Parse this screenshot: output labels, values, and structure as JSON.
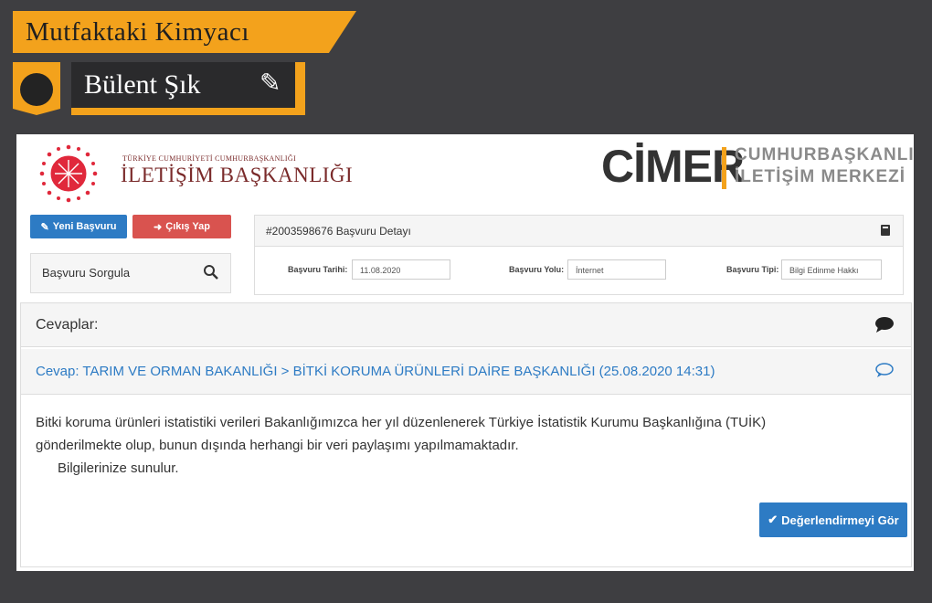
{
  "header": {
    "brand": "Mutfaktaki Kimyacı",
    "author": "Bülent Şık",
    "pencil_icon": "pencil-icon"
  },
  "site": {
    "institution_small": "TÜRKİYE CUMHURİYETİ CUMHURBAŞKANLIĞI",
    "institution_name": "İLETİŞİM BAŞKANLIĞI",
    "cimer": "CİMER",
    "cimer_line1": "CUMHURBAŞKANLIĞI",
    "cimer_line2": "İLETİŞİM MERKEZİ"
  },
  "sidebar": {
    "new_application": "Yeni Başvuru",
    "logout": "Çıkış Yap",
    "search_label": "Başvuru Sorgula"
  },
  "detail": {
    "title": "#2003598676 Başvuru Detayı",
    "date_label": "Başvuru Tarihi:",
    "date_value": "11.08.2020",
    "channel_label": "Başvuru Yolu:",
    "channel_value": "İnternet",
    "type_label": "Başvuru Tipi:",
    "type_value": "Bilgi Edinme Hakkı"
  },
  "answers": {
    "title": "Cevaplar:",
    "reply_header": "Cevap: TARIM VE ORMAN BAKANLIĞI > BİTKİ KORUMA ÜRÜNLERİ DAİRE BAŞKANLIĞI (25.08.2020 14:31)",
    "body_line1": "Bitki koruma ürünleri istatistiki verileri Bakanlığımızca her yıl düzenlenerek Türkiye İstatistik Kurumu Başkanlığına (TUİK)",
    "body_line2": "gönderilmekte olup, bunun dışında herhangi bir veri paylaşımı yapılmamaktadır.",
    "body_line3": "Bilgilerinize sunulur.",
    "evaluate_button": "Değerlendirmeyi Gör"
  },
  "colors": {
    "accent_orange": "#f3a21c",
    "primary_blue": "#2d7bc4",
    "danger_red": "#d9534f",
    "logo_red": "#e0283b"
  }
}
